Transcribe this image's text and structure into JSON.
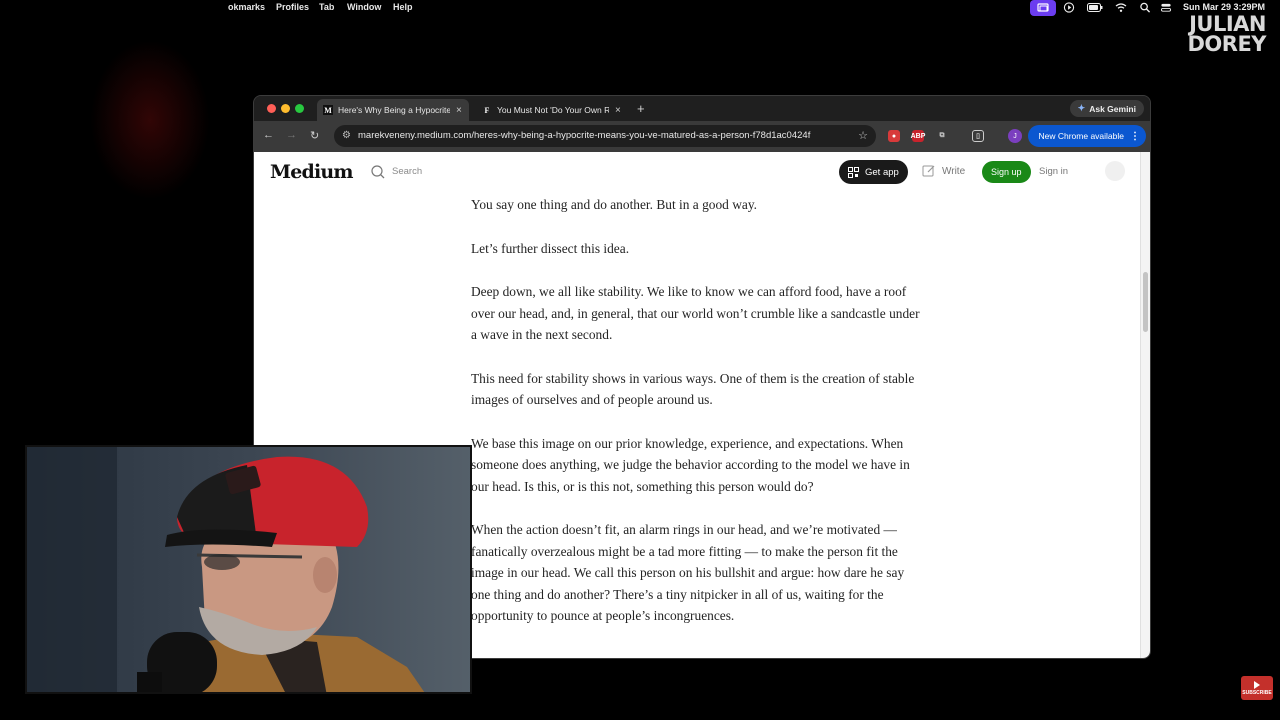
{
  "menubar": {
    "items": [
      "okmarks",
      "Profiles",
      "Tab",
      "Window",
      "Help"
    ],
    "clock": "Sun Mar 29  3:29PM"
  },
  "watermark": {
    "line1": "JULIAN",
    "line2": "DOREY"
  },
  "browser": {
    "tabs": [
      {
        "favicon": "M",
        "title": "Here's Why Being a Hypocrite",
        "active": true
      },
      {
        "favicon": "F",
        "title": "You Must Not 'Do Your Own R",
        "active": false
      }
    ],
    "ask_gemini": "Ask Gemini",
    "url": "marekveneny.medium.com/heres-why-being-a-hypocrite-means-you-ve-matured-as-a-person-f78d1ac0424f",
    "profile_initial": "J",
    "new_chrome": "New Chrome available"
  },
  "medium": {
    "logo": "Medium",
    "search_placeholder": "Search",
    "get_app": "Get app",
    "write": "Write",
    "sign_up": "Sign up",
    "sign_in": "Sign in"
  },
  "article": {
    "paragraphs": [
      "You say one thing and do another. But in a good way.",
      "Let’s further dissect this idea.",
      "Deep down, we all like stability. We like to know we can afford food, have a roof over our head, and, in general, that our world won’t crumble like a sandcastle under a wave in the next second.",
      "This need for stability shows in various ways. One of them is the creation of stable images of ourselves and of people around us.",
      "We base this image on our prior knowledge, experience, and expectations. When someone does anything, we judge the behavior according to the model we have in our head. Is this, or is this not, something this person would do?",
      "When the action doesn’t fit, an alarm rings in our head, and we’re motivated — fanatically overzealous might be a tad more fitting — to make the person fit the image in our head. We call this person on his bullshit and argue: how dare he say one thing and do another? There’s a tiny nitpicker in all of us, waiting for the opportunity to pounce at people’s incongruences."
    ]
  },
  "subscribe_label": "SUBSCRIBE",
  "colors": {
    "medium_green": "#1a8917",
    "chrome_blue": "#0b57d0",
    "menubar_active": "#6b3df0",
    "cap_red": "#c8232c"
  }
}
